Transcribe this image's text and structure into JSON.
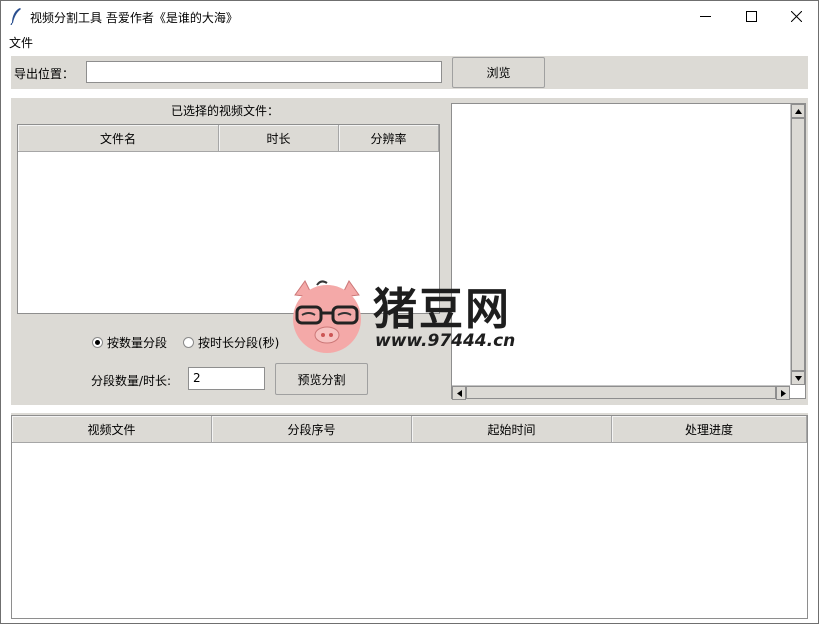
{
  "window": {
    "title": "视频分割工具 吾爱作者《是谁的大海》",
    "icon": "feather-icon"
  },
  "menu": {
    "file_label": "文件"
  },
  "export": {
    "label": "导出位置：",
    "value": "",
    "browse_label": "浏览"
  },
  "selected_files": {
    "heading": "已选择的视频文件：",
    "columns": [
      "文件名",
      "时长",
      "分辨率"
    ],
    "rows": []
  },
  "split_mode": {
    "options": [
      "按数量分段",
      "按时长分段(秒)"
    ],
    "selected": "按数量分段"
  },
  "segment": {
    "label": "分段数量/时长:",
    "value": "2",
    "preview_label": "预览分割"
  },
  "tasks": {
    "columns": [
      "视频文件",
      "分段序号",
      "起始时间",
      "处理进度"
    ],
    "rows": []
  },
  "watermark": {
    "brand": "猪豆网",
    "url": "www.97444.cn"
  },
  "colors": {
    "panel_bg": "#dcdad5",
    "pig_pink": "#f4a9a8"
  }
}
